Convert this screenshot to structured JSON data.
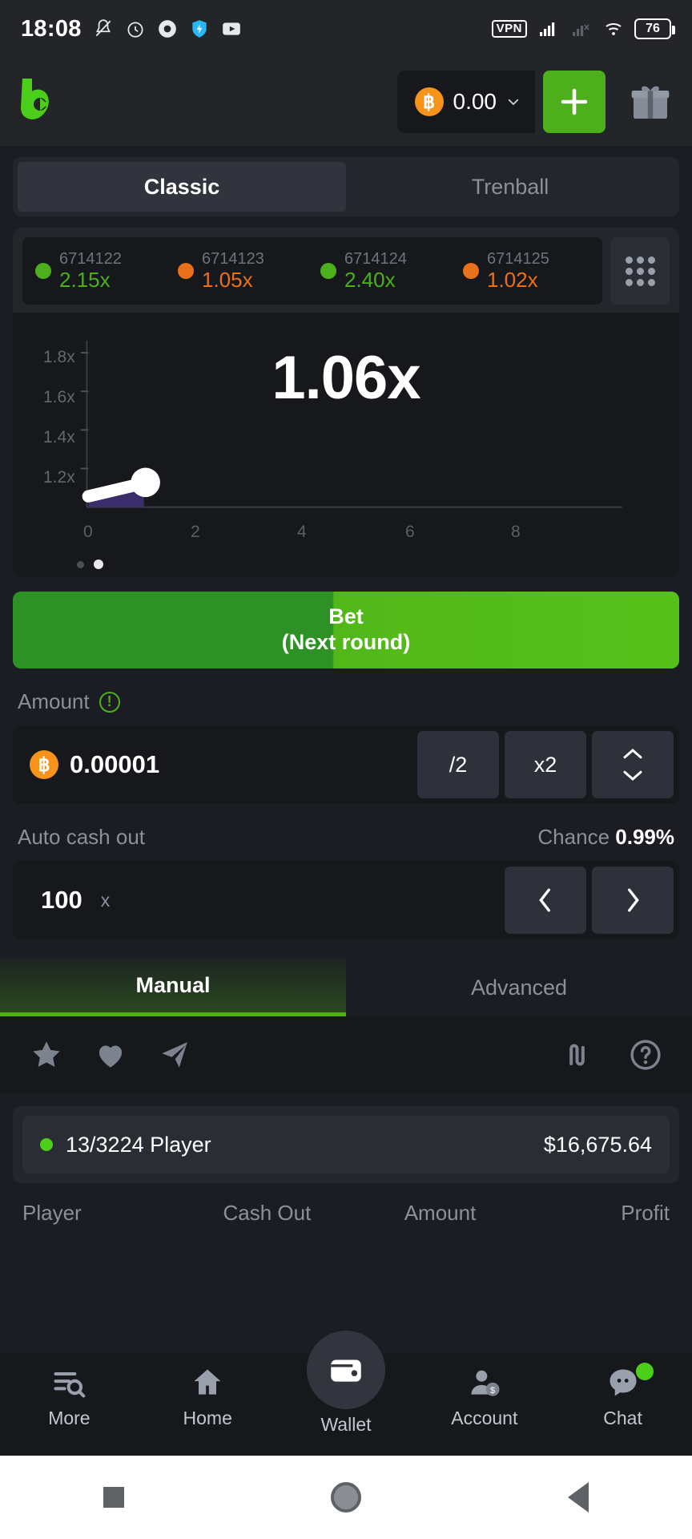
{
  "status_bar": {
    "time": "18:08",
    "left_icons": [
      "mute-icon",
      "alarm-icon",
      "chrome-icon",
      "vpn-shield-icon",
      "youtube-icon"
    ],
    "vpn_label": "VPN",
    "battery_level": "76",
    "right_icons": [
      "signal-strong-icon",
      "signal-off-icon",
      "wifi-icon"
    ]
  },
  "header": {
    "logo_name": "brand-logo",
    "balance": "0.00",
    "currency_icon": "bitcoin-icon",
    "deposit_label": "+",
    "gift_icon": "gift-icon"
  },
  "mode_tabs": [
    {
      "label": "Classic",
      "active": true
    },
    {
      "label": "Trenball",
      "active": false
    }
  ],
  "history": [
    {
      "id": "6714122",
      "multiplier": "2.15x",
      "color": "#4caf1b"
    },
    {
      "id": "6714123",
      "multiplier": "1.05x",
      "color": "#e8711a"
    },
    {
      "id": "6714124",
      "multiplier": "2.40x",
      "color": "#4caf1b"
    },
    {
      "id": "6714125",
      "multiplier": "1.02x",
      "color": "#e8711a"
    }
  ],
  "chart_data": {
    "type": "line",
    "title": "Crash multiplier curve",
    "current_multiplier": "1.06x",
    "x": [
      0,
      0.2,
      0.45,
      0.7,
      0.95,
      1.1
    ],
    "y": [
      1.0,
      1.01,
      1.025,
      1.04,
      1.055,
      1.06
    ],
    "xlabel": "",
    "ylabel": "",
    "xticks": [
      "0",
      "2",
      "4",
      "6",
      "8"
    ],
    "yticks": [
      "1.2x",
      "1.4x",
      "1.6x",
      "1.8x"
    ],
    "xlim": [
      0,
      9.5
    ],
    "ylim": [
      1.0,
      1.9
    ],
    "grid": false,
    "line_color": "#ffffff",
    "fill_color": "#3b2d6b",
    "point_color": "#ffffff",
    "legend": []
  },
  "bet_button": {
    "line1": "Bet",
    "line2": "(Next round)",
    "progress_pct": 48
  },
  "amount": {
    "label": "Amount",
    "warn_icon": "warning-icon",
    "currency_icon": "bitcoin-icon",
    "value": "0.00001",
    "half_label": "/2",
    "double_label": "x2",
    "stepper_icon": "up-down-chevron-icon"
  },
  "auto_cashout": {
    "label": "Auto cash out",
    "chance_label": "Chance",
    "chance_value": "0.99%",
    "value": "100",
    "unit": "x",
    "prev_icon": "chevron-left-icon",
    "next_icon": "chevron-right-icon"
  },
  "bet_mode_tabs": [
    {
      "label": "Manual",
      "active": true
    },
    {
      "label": "Advanced",
      "active": false
    }
  ],
  "icon_bar": {
    "left": [
      "star-icon",
      "heart-icon",
      "send-icon"
    ],
    "right": [
      "trend-icon",
      "help-icon"
    ]
  },
  "players": {
    "summary_count": "13/3224 Player",
    "summary_amount": "$16,675.64",
    "columns": [
      "Player",
      "Cash Out",
      "Amount",
      "Profit"
    ]
  },
  "bottom_nav": [
    {
      "label": "More",
      "icon": "more-search-icon"
    },
    {
      "label": "Home",
      "icon": "home-icon"
    },
    {
      "label": "Wallet",
      "icon": "wallet-icon"
    },
    {
      "label": "Account",
      "icon": "account-icon"
    },
    {
      "label": "Chat",
      "icon": "chat-icon",
      "badge": true
    }
  ],
  "android_nav": [
    "recents-button",
    "home-button",
    "back-button"
  ],
  "colors": {
    "accent_green": "#4caf1b",
    "orange": "#e8711a",
    "bg": "#1b1d22",
    "panel": "#24262c",
    "dark": "#16181c"
  }
}
